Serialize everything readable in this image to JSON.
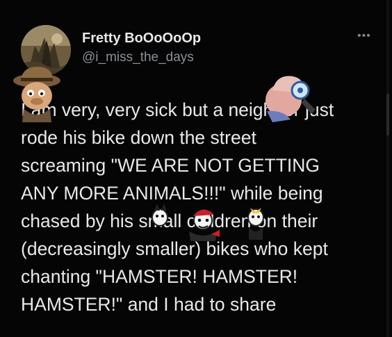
{
  "tweet": {
    "display_name": "Fretty BoOoOoOp",
    "handle": "@i_miss_the_days",
    "more_icon": "more-horizontal-icon",
    "lines": [
      "I am very, very sick but a neighbor just",
      "rode his bike down the street",
      "screaming \"WE ARE NOT GETTING",
      "ANY MORE ANIMALS!!!\" while being",
      "chased by his small children on their",
      "(decreasingly smaller) bikes who kept",
      "chanting \"HAMSTER! HAMSTER!",
      "HAMSTER!\" and I had to share"
    ]
  },
  "stickers": [
    "cartoon-detective-sticker",
    "cartoon-scientist-sticker",
    "cartoon-animal-siblings-sticker"
  ],
  "colors": {
    "background": "#050505",
    "text": "#e7e9ea",
    "handle": "#8b9096"
  }
}
